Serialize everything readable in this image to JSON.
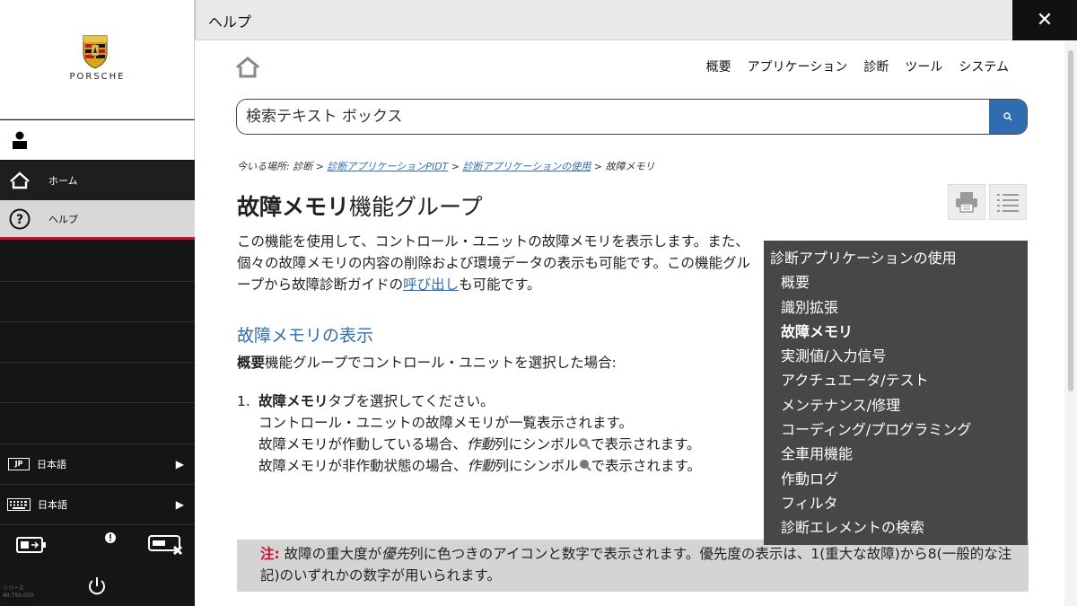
{
  "sidebar": {
    "brand_name": "PORSCHE",
    "nav": [
      {
        "label": "ホーム",
        "icon": "home-icon"
      },
      {
        "label": "ヘルプ",
        "icon": "help-icon"
      }
    ],
    "country_badge": "JP",
    "language_label": "日本語",
    "keyboard_label": "日本語",
    "version_line1": "リリース",
    "version_line2": "40.750.050"
  },
  "header": {
    "title": "ヘルプ"
  },
  "help": {
    "topnav": [
      "概要",
      "アプリケーション",
      "診断",
      "ツール",
      "システム"
    ],
    "search_placeholder": "検索テキスト ボックス",
    "breadcrumb": {
      "prefix": "今いる場所: 診断 > ",
      "link1": "診断アプリケーションPIDT",
      "sep1": " > ",
      "link2": "診断アプリケーションの使用",
      "tail": " > 故障メモリ"
    },
    "title_strong": "故障メモリ",
    "title_rest": "機能グループ",
    "intro_before_link": "この機能を使用して、コントロール・ユニットの故障メモリを表示します。また、個々の故障メモリの内容の削除および環境データの表示も可能です。この機能グループから故障診断ガイドの",
    "intro_link": "呼び出し",
    "intro_after_link": "も可能です。",
    "section_title": "故障メモリの表示",
    "section_intro_strong": "概要",
    "section_intro_rest": "機能グループでコントロール・ユニットを選択した場合:",
    "step_number": "1.",
    "step_strong": "故障メモリ",
    "step_rest": "タブを選択してください。",
    "step_line2": "コントロール・ユニットの故障メモリが一覧表示されます。",
    "step_line3_a": "故障メモリが作動している場合、",
    "step_line3_em": "作動",
    "step_line3_b": "列にシンボル",
    "step_line3_c": "で表示されます。",
    "step_line4_a": "故障メモリが非作動状態の場合、",
    "step_line4_em": "作動",
    "step_line4_b": "列にシンボル",
    "step_line4_c": "で表示されます。",
    "note_label": "注:",
    "note_a": " 故障の重大度が",
    "note_em": "優先",
    "note_b": "列に色つきのアイコンと数字で表示されます。優先度の表示は、1(重大な故障)から8(一般的な注記)のいずれかの数字が用いられます。",
    "toc_title": "診断アプリケーションの使用",
    "toc_items": [
      "概要",
      "識別拡張",
      "故障メモリ",
      "実測値/入力信号",
      "アクチュエータ/テスト",
      "メンテナンス/修理",
      "コーディング/プログラミング",
      "全車用機能",
      "作動ログ",
      "フィルタ",
      "診断エレメントの検索"
    ],
    "toc_current": "故障メモリ"
  },
  "colors": {
    "accent_red": "#c8102e",
    "link_blue": "#2f6db1",
    "toc_bg": "#474747",
    "sidebar_bg": "#151515"
  }
}
